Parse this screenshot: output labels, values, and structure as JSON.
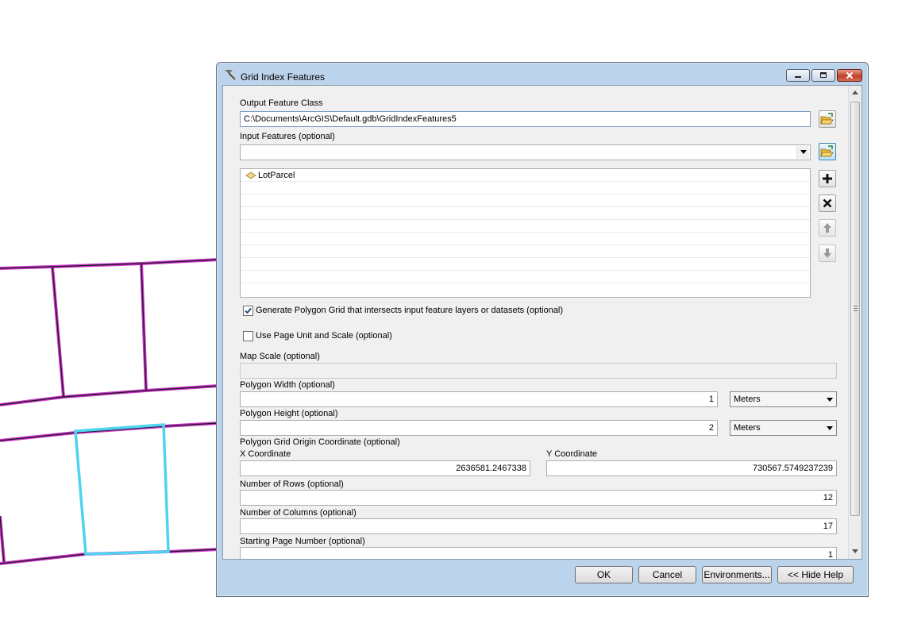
{
  "dialog": {
    "title": "Grid Index Features",
    "output_feature_class": {
      "label": "Output Feature Class",
      "value": "C:\\Documents\\ArcGIS\\Default.gdb\\GridIndexFeatures5"
    },
    "input_features": {
      "label": "Input Features (optional)",
      "value": "",
      "items": [
        {
          "name": "LotParcel",
          "icon": "polygon-layer-icon"
        }
      ]
    },
    "generate_polygon_grid": {
      "label": "Generate Polygon Grid that intersects input feature layers or datasets (optional)",
      "checked": true
    },
    "use_page_unit": {
      "label": "Use Page Unit and Scale (optional)",
      "checked": false
    },
    "map_scale": {
      "label": "Map Scale (optional)",
      "value": ""
    },
    "polygon_width": {
      "label": "Polygon Width (optional)",
      "value": "1",
      "unit": "Meters"
    },
    "polygon_height": {
      "label": "Polygon Height (optional)",
      "value": "2",
      "unit": "Meters"
    },
    "origin": {
      "label": "Polygon Grid Origin Coordinate (optional)",
      "x_label": "X Coordinate",
      "x_value": "2636581.2467338",
      "y_label": "Y Coordinate",
      "y_value": "730567.5749237239"
    },
    "rows": {
      "label": "Number of Rows (optional)",
      "value": "12"
    },
    "columns": {
      "label": "Number of Columns (optional)",
      "value": "17"
    },
    "starting_page": {
      "label": "Starting Page Number (optional)",
      "value": "1"
    },
    "buttons": {
      "ok": "OK",
      "cancel": "Cancel",
      "environments": "Environments...",
      "hide_help": "<< Hide Help"
    }
  },
  "colors": {
    "parcel_outline": "#cc33cc",
    "selected_parcel": "#4fd3f0"
  }
}
